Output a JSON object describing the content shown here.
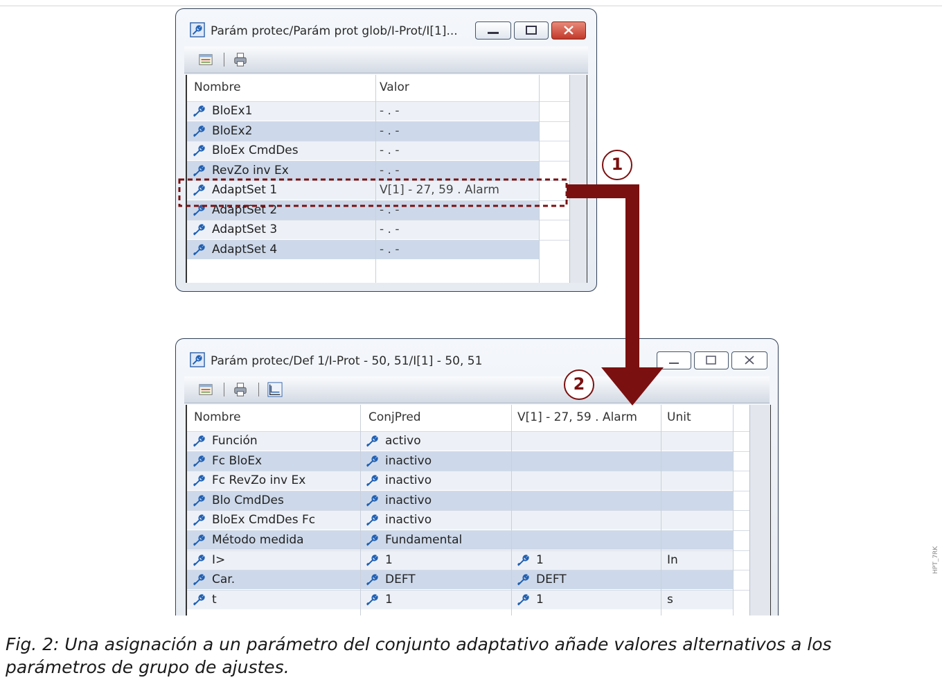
{
  "window1": {
    "title": "Parám protec/Parám prot glob/I-Prot/I[1]...",
    "columns": [
      "Nombre",
      "Valor"
    ],
    "rows": [
      {
        "name": "BloEx1",
        "value": "- . -"
      },
      {
        "name": "BloEx2",
        "value": "- . -"
      },
      {
        "name": "BloEx CmdDes",
        "value": "- . -"
      },
      {
        "name": "RevZo inv Ex",
        "value": "- . -"
      },
      {
        "name": "AdaptSet 1",
        "value": "V[1] - 27, 59 . Alarm"
      },
      {
        "name": "AdaptSet 2",
        "value": "- . -"
      },
      {
        "name": "AdaptSet 3",
        "value": "- . -"
      },
      {
        "name": "AdaptSet 4",
        "value": "- . -"
      }
    ]
  },
  "window2": {
    "title": "Parám protec/Def 1/I-Prot - 50, 51/I[1] - 50, 51",
    "columns": [
      "Nombre",
      "ConjPred",
      "V[1] - 27, 59 . Alarm",
      "Unit"
    ],
    "rows": [
      {
        "name": "Función",
        "pred": "activo",
        "alt": "",
        "unit": ""
      },
      {
        "name": "Fc BloEx",
        "pred": "inactivo",
        "alt": "",
        "unit": ""
      },
      {
        "name": "Fc RevZo inv Ex",
        "pred": "inactivo",
        "alt": "",
        "unit": ""
      },
      {
        "name": "Blo CmdDes",
        "pred": "inactivo",
        "alt": "",
        "unit": ""
      },
      {
        "name": "BloEx CmdDes Fc",
        "pred": "inactivo",
        "alt": "",
        "unit": ""
      },
      {
        "name": "Método medida",
        "pred": "Fundamental",
        "alt": "",
        "unit": ""
      },
      {
        "name": "I>",
        "pred": "1",
        "alt": "1",
        "unit": "In"
      },
      {
        "name": "Car.",
        "pred": "DEFT",
        "alt": "DEFT",
        "unit": ""
      },
      {
        "name": "t",
        "pred": "1",
        "alt": "1",
        "unit": "s"
      }
    ]
  },
  "callouts": [
    "1",
    "2"
  ],
  "caption": "Fig. 2: Una asignación a un parámetro del conjunto adaptativo añade valores alternativos a los parámetros de grupo de ajustes.",
  "side_code": "HPT_7RK",
  "colors": {
    "arrow": "#7b1010",
    "row_alt": "#cdd9ea",
    "row_light": "#edf1f7",
    "frame": "#2f3f55"
  },
  "icons": [
    "app-icon",
    "properties-icon",
    "print-icon",
    "chart-icon",
    "minimize-icon",
    "maximize-icon",
    "close-icon",
    "wrench-icon"
  ]
}
